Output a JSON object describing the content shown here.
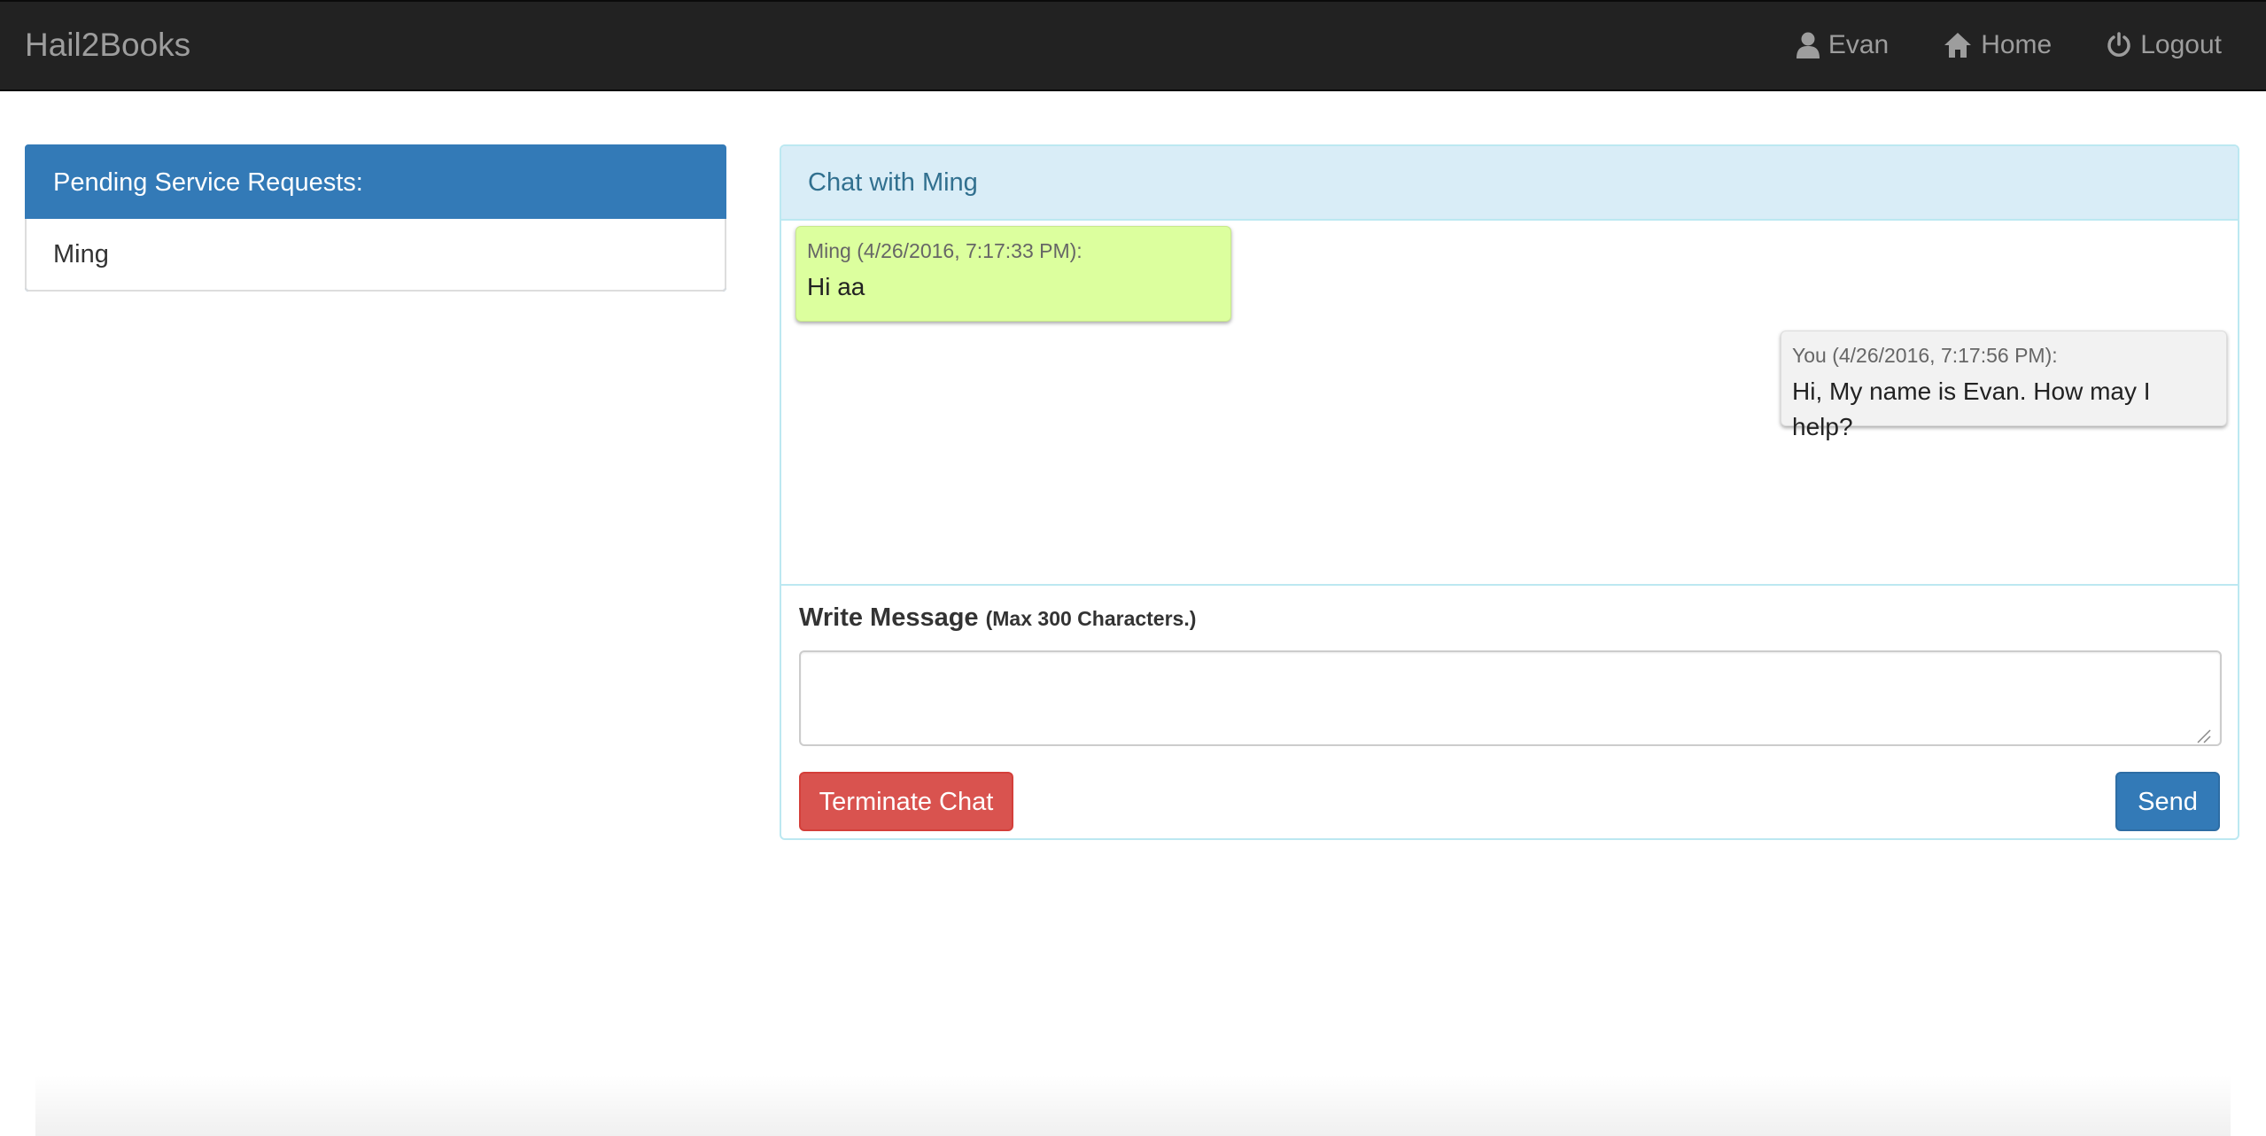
{
  "navbar": {
    "brand": "Hail2Books",
    "user_label": "Evan",
    "home_label": "Home",
    "logout_label": "Logout",
    "icons": [
      "user-icon",
      "home-icon",
      "power-icon"
    ]
  },
  "pending": {
    "heading": "Pending Service Requests:",
    "items": [
      {
        "label": "Ming"
      }
    ]
  },
  "chat": {
    "heading": "Chat with Ming",
    "messages": [
      {
        "meta": "Ming (4/26/2016, 7:17:33 PM):",
        "text": "Hi aa"
      },
      {
        "meta": "You (4/26/2016, 7:17:56 PM):",
        "text": "Hi, My name is Evan. How may I help?"
      }
    ],
    "compose": {
      "label": "Write Message",
      "hint": "(Max 300 Characters.)",
      "value": "",
      "placeholder": ""
    },
    "terminate_label": "Terminate Chat",
    "send_label": "Send"
  },
  "colors": {
    "navbar_bg": "#222222",
    "primary": "#337ab7",
    "danger": "#d9534f",
    "info_bg": "#d9edf7",
    "their_bubble": "#dcff9e",
    "your_bubble": "#f2f2f2"
  }
}
